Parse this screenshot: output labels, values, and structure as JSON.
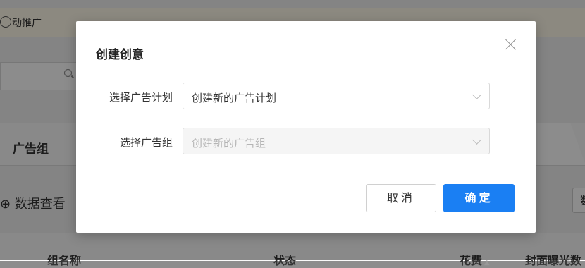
{
  "background": {
    "notice_text": "动推广",
    "tab_label": "广告组",
    "toolbar_text": "⊕ 数据查看",
    "toolbar_right_button": "数",
    "table_headers": {
      "name": "组名称",
      "status": "状态",
      "cost": "花费",
      "exposure": "封面曝光数"
    }
  },
  "modal": {
    "title": "创建创意",
    "fields": [
      {
        "label": "选择广告计划",
        "value": "创建新的广告计划",
        "disabled": false
      },
      {
        "label": "选择广告组",
        "value": "创建新的广告组",
        "disabled": true
      }
    ],
    "cancel_label": "取消",
    "ok_label": "确定"
  },
  "colors": {
    "primary": "#1a7ff3",
    "overlay": "rgba(0,0,0,0.45)"
  },
  "icons": [
    "close-icon",
    "chevron-down-icon",
    "search-icon",
    "sort-icon"
  ]
}
